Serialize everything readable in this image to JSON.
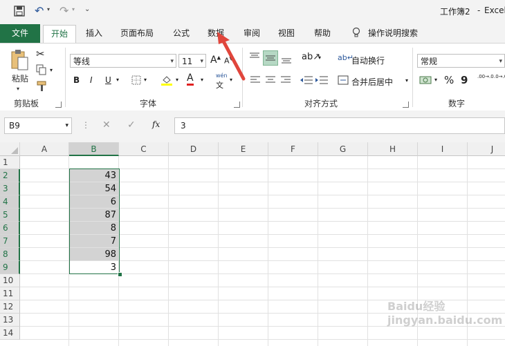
{
  "title_bar": {
    "workbook": "工作簿2",
    "separator": "-",
    "app": "Excel"
  },
  "tabs": [
    "文件",
    "开始",
    "插入",
    "页面布局",
    "公式",
    "数据",
    "审阅",
    "视图",
    "帮助"
  ],
  "tell_me": "操作说明搜索",
  "ribbon": {
    "clipboard": {
      "paste": "粘贴",
      "label": "剪贴板"
    },
    "font": {
      "name": "等线",
      "size": "11",
      "bold": "B",
      "italic": "I",
      "underline": "U",
      "label": "字体",
      "wen": "wén",
      "font_color_letter": "A",
      "grow": "A",
      "shrink": "A"
    },
    "alignment": {
      "wrap": "自动换行",
      "merge": "合并后居中",
      "label": "对齐方式"
    },
    "number": {
      "format": "常规",
      "percent": "%",
      "comma": "9",
      "label": "数字",
      "dec_inc": ".00→.0",
      "dec_dec": ".0→.00"
    }
  },
  "formula_bar": {
    "name_box": "B9",
    "fx": "fx",
    "value": "3"
  },
  "grid": {
    "columns": [
      "A",
      "B",
      "C",
      "D",
      "E",
      "F",
      "G",
      "H",
      "I",
      "J"
    ],
    "rows": [
      "1",
      "2",
      "3",
      "4",
      "5",
      "6",
      "7",
      "8",
      "9",
      "10",
      "11",
      "12",
      "13",
      "14"
    ],
    "b_values": [
      "",
      "43",
      "54",
      "6",
      "87",
      "8",
      "7",
      "98",
      "3"
    ]
  },
  "watermark": "Baidu经验 jingyan.baidu.com",
  "colors": {
    "excel_green": "#217346",
    "selection_gray": "#d3d3d3",
    "arrow_red": "#e0463c"
  }
}
